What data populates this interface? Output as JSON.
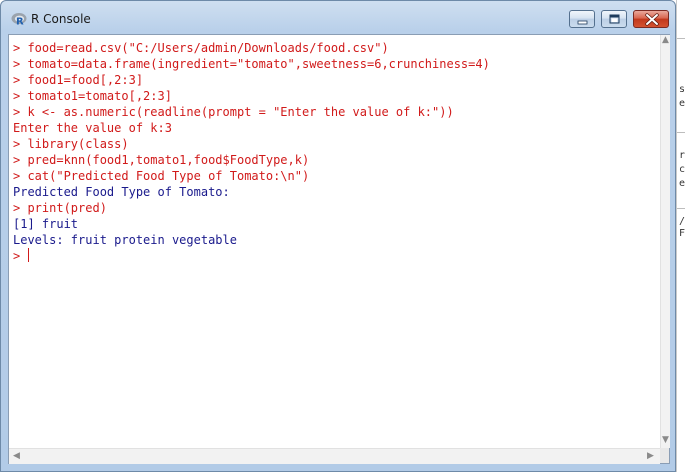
{
  "window": {
    "title": "R Console",
    "controls": {
      "minimize_icon": "minimize-icon",
      "maximize_icon": "maximize-icon",
      "close_icon": "close-icon"
    }
  },
  "console": {
    "lines": [
      {
        "text": "> food=read.csv(\"C:/Users/admin/Downloads/food.csv\")",
        "kind": "command"
      },
      {
        "text": "> tomato=data.frame(ingredient=\"tomato\",sweetness=6,crunchiness=4)",
        "kind": "command"
      },
      {
        "text": "> food1=food[,2:3]",
        "kind": "command"
      },
      {
        "text": "> tomato1=tomato[,2:3]",
        "kind": "command"
      },
      {
        "text": "> k <- as.numeric(readline(prompt = \"Enter the value of k:\"))",
        "kind": "command"
      },
      {
        "text": "Enter the value of k:3",
        "kind": "command"
      },
      {
        "text": "> library(class)",
        "kind": "command"
      },
      {
        "text": "> pred=knn(food1,tomato1,food$FoodType,k)",
        "kind": "command"
      },
      {
        "text": "> cat(\"Predicted Food Type of Tomato:\\n\")",
        "kind": "command"
      },
      {
        "text": "Predicted Food Type of Tomato:",
        "kind": "output"
      },
      {
        "text": "> print(pred)",
        "kind": "command"
      },
      {
        "text": "[1] fruit",
        "kind": "output"
      },
      {
        "text": "Levels: fruit protein vegetable",
        "kind": "output"
      },
      {
        "text": "> ",
        "kind": "command"
      }
    ],
    "colors": {
      "command": "#d11a1a",
      "output": "#1a1a8c"
    }
  },
  "background_window": {
    "chars": [
      "s",
      "e",
      "r",
      "c",
      "e",
      "/",
      "F"
    ]
  }
}
